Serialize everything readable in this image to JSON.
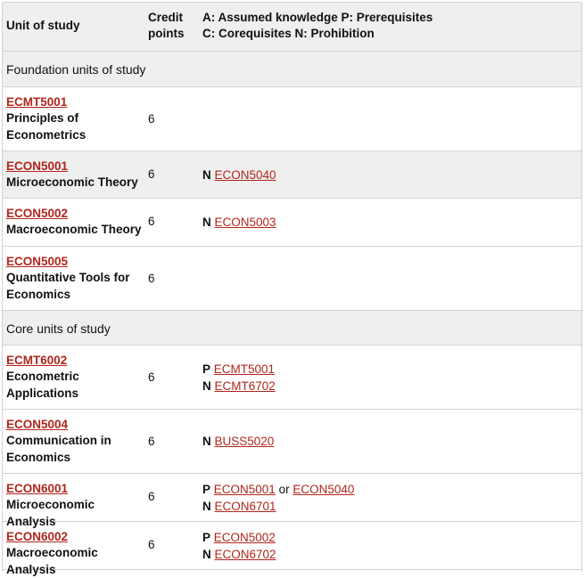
{
  "header": {
    "col_unit": "Unit of study",
    "col_credit_line1": "Credit",
    "col_credit_line2": "points",
    "col_req_line1": "A: Assumed knowledge P: Prerequisites",
    "col_req_line2": "C: Corequisites N: Prohibition"
  },
  "sections": {
    "foundation": "Foundation units of study",
    "core": "Core units of study"
  },
  "rows": [
    {
      "code": "ECMT5001",
      "title_1": "Principles of",
      "title_2": "Econometrics",
      "credit": "6"
    },
    {
      "code": "ECON5001",
      "title_1": "Microeconomic Theory",
      "credit": "6",
      "req1_type": "N",
      "req1_link": "ECON5040"
    },
    {
      "code": "ECON5002",
      "title_1": "Macroeconomic Theory",
      "credit": "6",
      "req1_type": "N",
      "req1_link": "ECON5003"
    },
    {
      "code": "ECON5005",
      "title_1": "Quantitative Tools for",
      "title_2": "Economics",
      "credit": "6"
    },
    {
      "code": "ECMT6002",
      "title_1": "Econometric",
      "title_2": "Applications",
      "credit": "6",
      "req1_type": "P",
      "req1_link": "ECMT5001",
      "req2_type": "N",
      "req2_link": "ECMT6702"
    },
    {
      "code": "ECON5004",
      "title_1": "Communication in",
      "title_2": "Economics",
      "credit": "6",
      "req1_type": "N",
      "req1_link": "BUSS5020"
    },
    {
      "code": "ECON6001",
      "title_1": "Microeconomic Analysis",
      "credit": "6",
      "req1_type": "P",
      "req1_link": "ECON5001",
      "req1_joiner": "or",
      "req1_link2": "ECON5040",
      "req2_type": "N",
      "req2_link": "ECON6701"
    },
    {
      "code": "ECON6002",
      "title_1": "Macroeconomic Analysis",
      "credit": "6",
      "req1_type": "P",
      "req1_link": "ECON5002",
      "req2_type": "N",
      "req2_link": "ECON6702"
    }
  ]
}
